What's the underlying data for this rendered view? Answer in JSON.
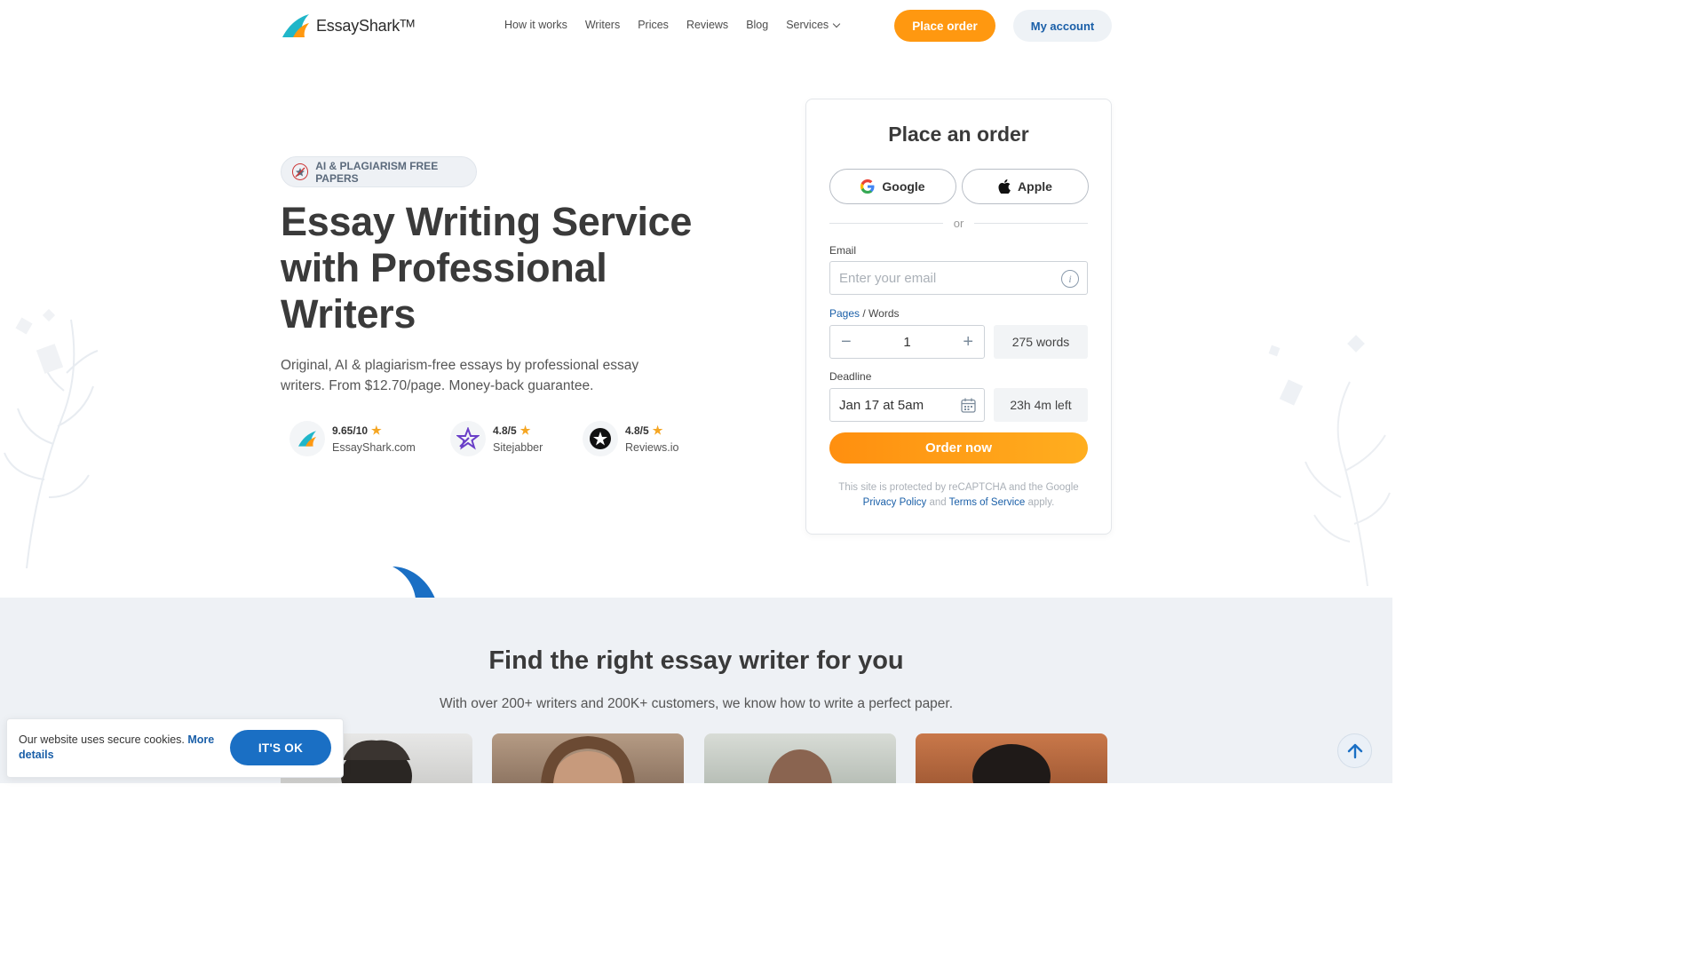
{
  "header": {
    "brand": "EssaySharkᵀᴹ",
    "nav": [
      "How it works",
      "Writers",
      "Prices",
      "Reviews",
      "Blog",
      "Services"
    ],
    "place_order": "Place order",
    "my_account": "My account"
  },
  "hero": {
    "badge": "AI & PLAGIARISM FREE PAPERS",
    "title": "Essay Writing Service with Professional Writers",
    "lead": "Original, AI & plagiarism-free essays by professional essay writers. From $12.70/page. Money-back guarantee.",
    "ratings": [
      {
        "score": "9.65/10",
        "source": "EssayShark.com"
      },
      {
        "score": "4.8/5",
        "source": "Sitejabber"
      },
      {
        "score": "4.8/5",
        "source": "Reviews.io"
      }
    ]
  },
  "order": {
    "title": "Place an order",
    "google": "Google",
    "apple": "Apple",
    "or": "or",
    "email_label": "Email",
    "email_placeholder": "Enter your email",
    "pages_label": "Pages",
    "words_label": "/ Words",
    "pages_value": "1",
    "words_value": "275 words",
    "deadline_label": "Deadline",
    "deadline_value": "Jan 17 at 5am",
    "time_left": "23h 4m left",
    "order_now": "Order now",
    "captcha_text": "This site is protected by reCAPTCHA and the Google",
    "privacy": "Privacy Policy",
    "and": "and",
    "terms": "Terms of Service",
    "apply": "apply."
  },
  "writers_section": {
    "title": "Find the right essay writer for you",
    "subtitle": "With over 200+ writers and 200K+ customers, we know how to write a perfect paper."
  },
  "cookie": {
    "text": "Our website uses secure cookies.",
    "link": "More details",
    "button": "IT'S OK"
  },
  "colors": {
    "accent_orange": "#ff9810",
    "link_blue": "#1a5fa8",
    "section_bg": "#eef1f5"
  }
}
